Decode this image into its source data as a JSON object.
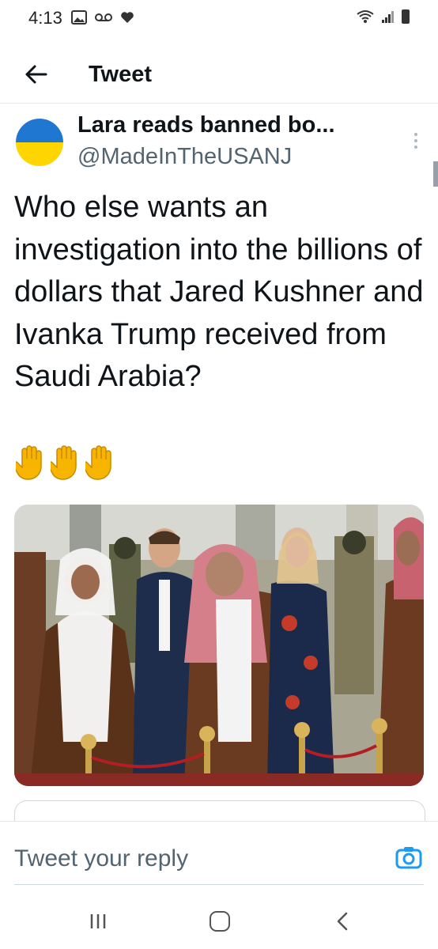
{
  "status_bar": {
    "time": "4:13",
    "left_icons": [
      "image-icon",
      "voicemail-icon",
      "heart-icon"
    ],
    "right_icons": [
      "wifi-icon",
      "signal-icon",
      "battery-icon"
    ]
  },
  "header": {
    "title": "Tweet"
  },
  "tweet": {
    "display_name": "Lara reads banned bo...",
    "handle": "@MadeInTheUSANJ",
    "text": "Who else wants an investigation into the billions of dollars that Jared Kushner and Ivanka Trump received from Saudi Arabia?",
    "emoji": [
      "✋",
      "✋",
      "✋"
    ],
    "avatar_colors": {
      "top": "#1f77d2",
      "bottom": "#ffd500"
    }
  },
  "reply": {
    "placeholder": "Tweet your reply"
  },
  "colors": {
    "accent": "#1d9bf0",
    "secondary_text": "#536471"
  }
}
